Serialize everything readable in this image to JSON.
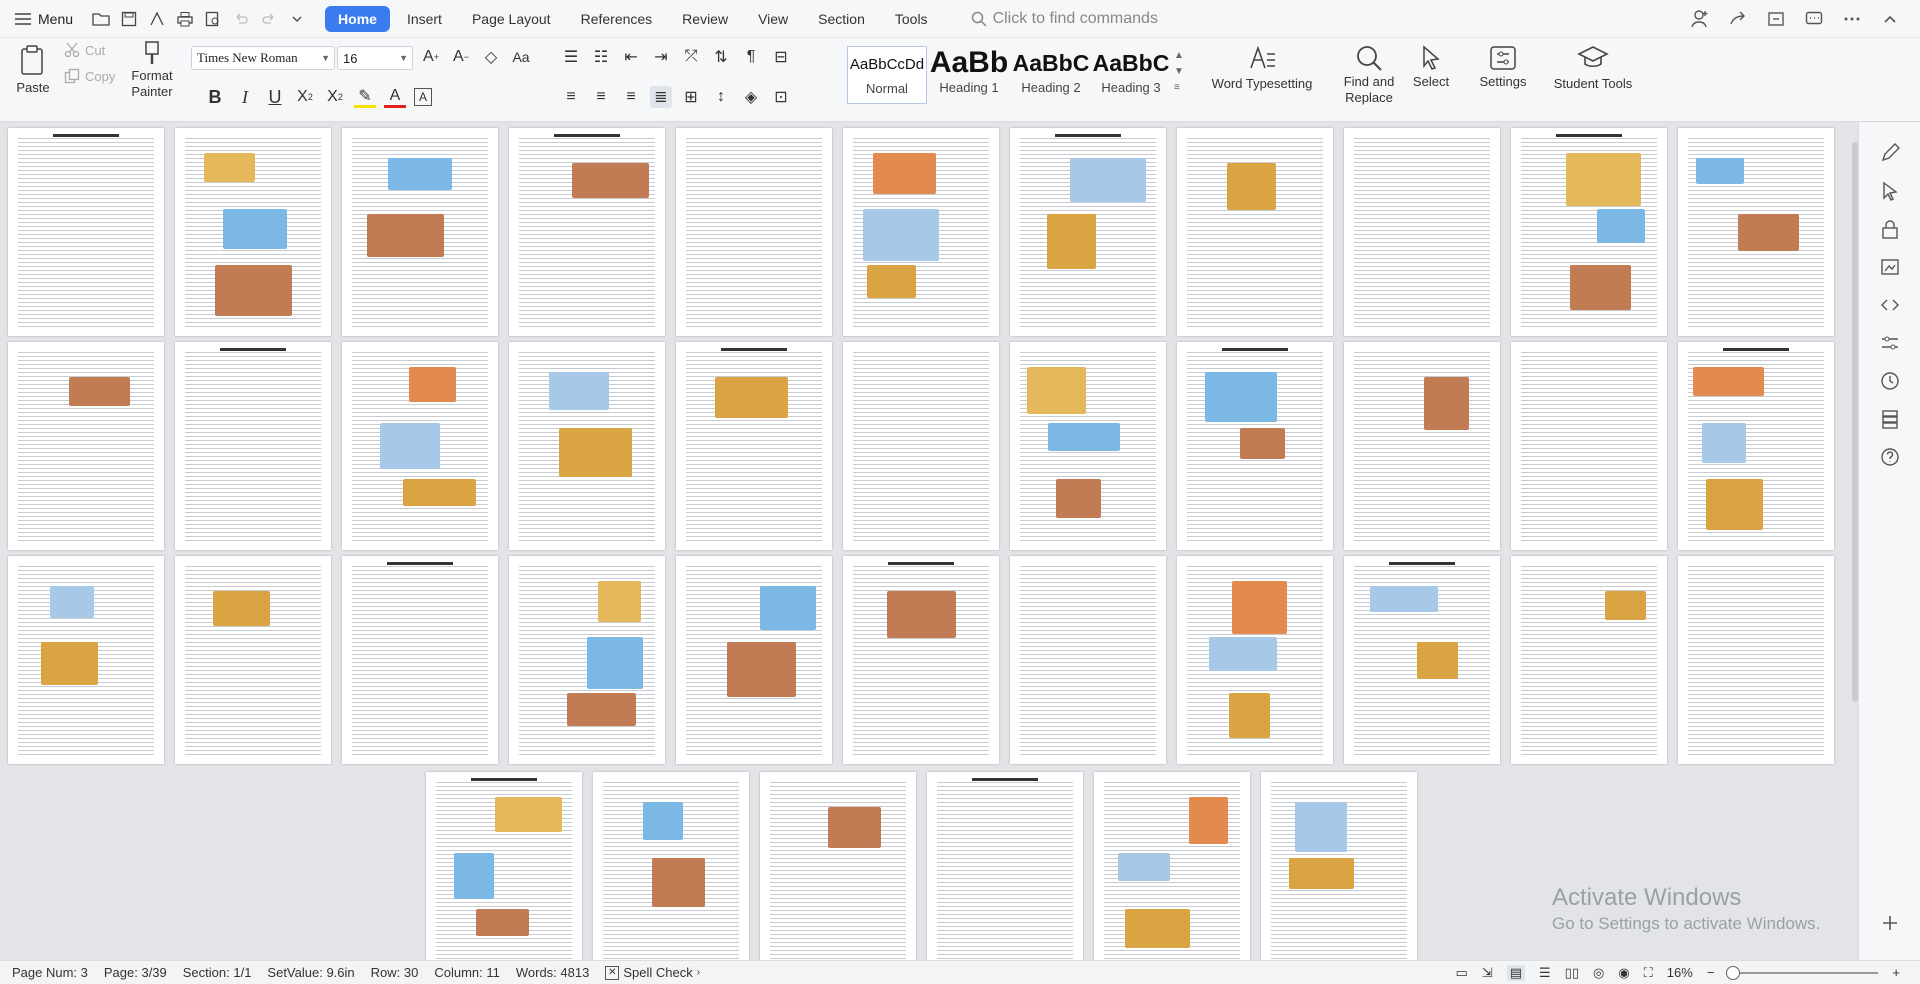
{
  "topbar": {
    "menu_label": "Menu",
    "tabs": [
      {
        "label": "Home",
        "active": true
      },
      {
        "label": "Insert"
      },
      {
        "label": "Page Layout"
      },
      {
        "label": "References"
      },
      {
        "label": "Review"
      },
      {
        "label": "View"
      },
      {
        "label": "Section"
      },
      {
        "label": "Tools"
      }
    ],
    "search_placeholder": "Click to find commands"
  },
  "ribbon": {
    "paste_label": "Paste",
    "cut_label": "Cut",
    "copy_label": "Copy",
    "format_painter_label": "Format Painter",
    "font_name": "Times New Roman",
    "font_size": "16",
    "styles": [
      {
        "preview": "AaBbCcDd",
        "label": "Normal"
      },
      {
        "preview": "AaBb",
        "label": "Heading 1"
      },
      {
        "preview": "AaBbC",
        "label": "Heading 2"
      },
      {
        "preview": "AaBbC",
        "label": "Heading 3"
      }
    ],
    "word_typesetting_label": "Word Typesetting",
    "find_replace_label": "Find and Replace",
    "select_label": "Select",
    "settings_label": "Settings",
    "student_tools_label": "Student Tools"
  },
  "status": {
    "page_num": "Page Num: 3",
    "page": "Page: 3/39",
    "section": "Section: 1/1",
    "set_value": "SetValue: 9.6in",
    "row": "Row: 30",
    "column": "Column: 11",
    "words": "Words: 4813",
    "spell_check": "Spell Check",
    "zoom": "16%"
  },
  "watermark": {
    "line1": "Activate Windows",
    "line2": "Go to Settings to activate Windows."
  },
  "colors": {
    "accent": "#3a7bf0",
    "ribbon_bg": "#f6f7f9",
    "canvas_bg": "#e3e4e8"
  }
}
